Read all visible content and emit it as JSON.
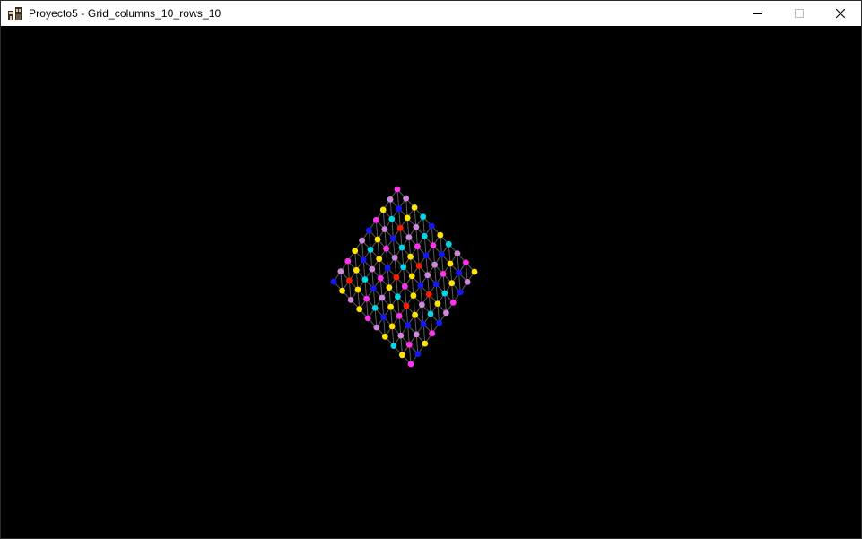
{
  "window": {
    "title": "Proyecto5 - Grid_columns_10_rows_10",
    "icon": "app-icon",
    "controls": [
      "minimize-icon",
      "maximize-icon",
      "close-icon"
    ]
  },
  "scene": {
    "background": "#000000",
    "grid_columns": 10,
    "grid_rows": 10,
    "line_color": "#5a5a5a",
    "palette": {
      "Y": "#ffe400",
      "M": "#ff33ee",
      "L": "#cc88dd",
      "B": "#1515ff",
      "C": "#00d6e6",
      "R": "#ff1a00"
    },
    "node_colors": [
      "MLYCBYCLMY",
      "LBYLCMBYBL",
      "YCRLMBLMYB",
      "MLBCYRLBCM",
      "BYMLCYBRYL",
      "LCYBRMYLCB",
      "YBLMYCRYBM",
      "MYCBLYMBLY",
      "LRYMCBYLMB",
      "BYLYMLYCYM"
    ]
  }
}
